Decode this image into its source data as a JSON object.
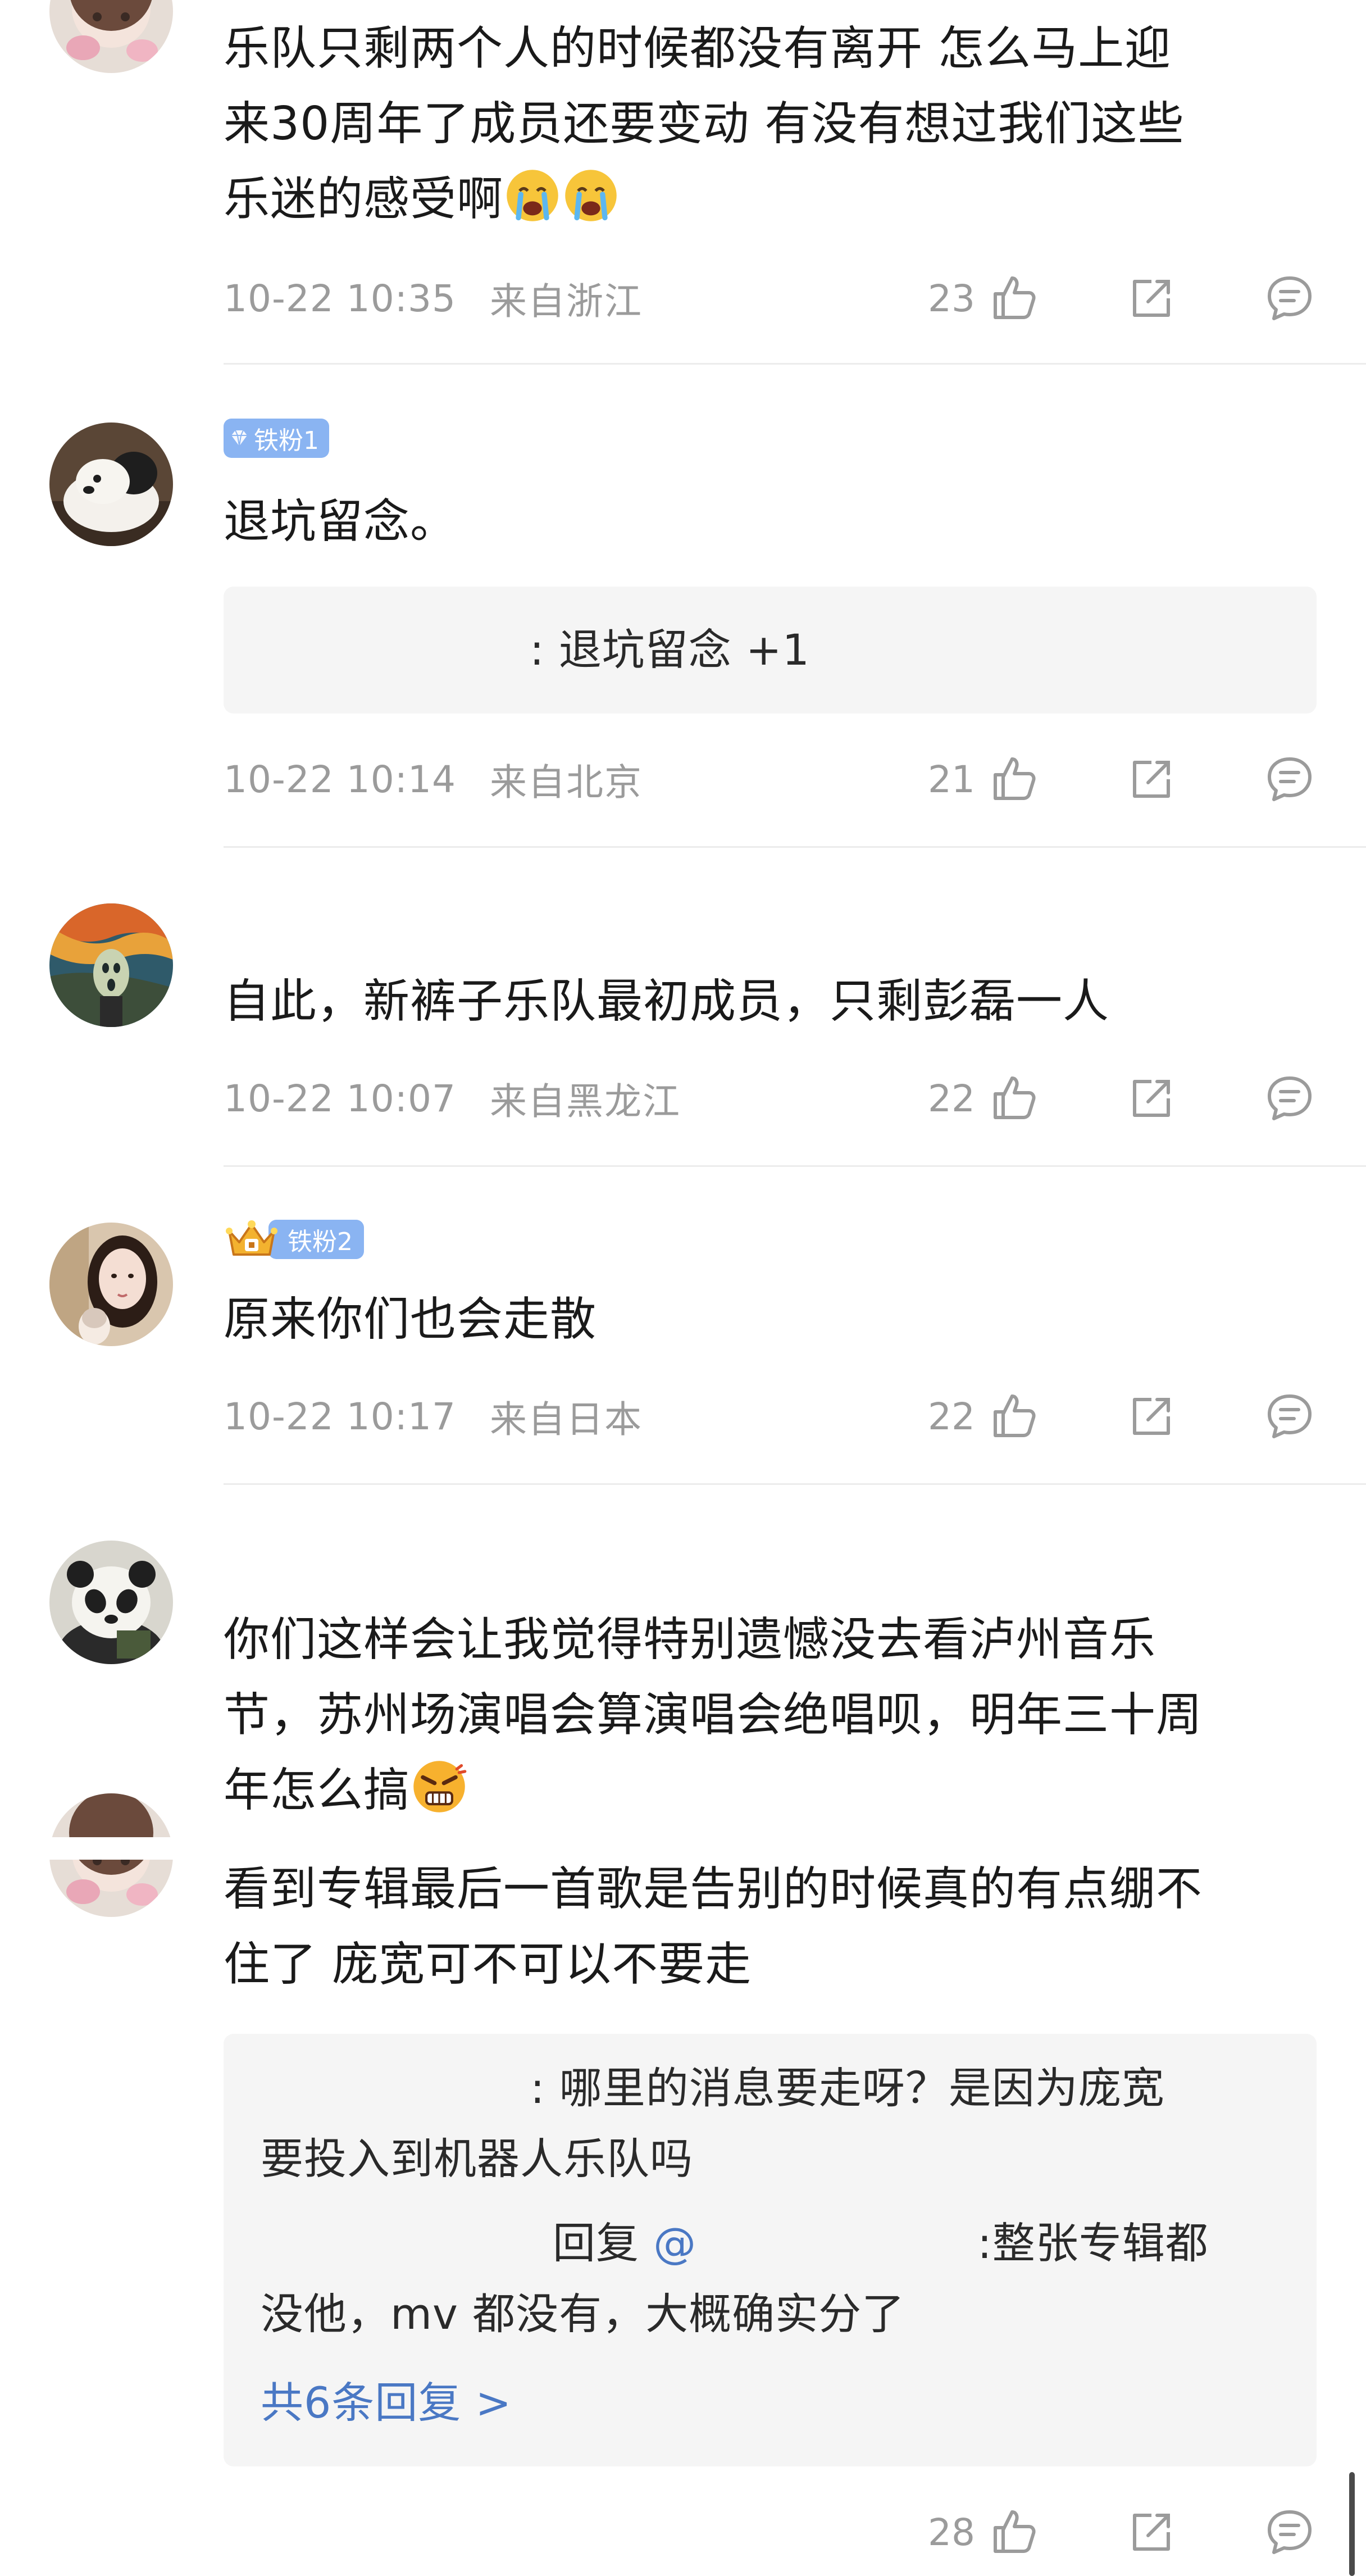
{
  "comments": [
    {
      "text": "乐队只剩两个人的时候都没有离开 怎么马上迎来30周年了成员还要变动 有没有想过我们这些乐迷的感受啊",
      "emoji": [
        "crying-face",
        "crying-face"
      ],
      "time": "10-22 10:35",
      "location": "来自浙江",
      "likes": "23"
    },
    {
      "badge": "铁粉1",
      "text": "退坑留念。",
      "reply": ": 退坑留念 +1",
      "time": "10-22 10:14",
      "location": "来自北京",
      "likes": "21"
    },
    {
      "text": "自此，新裤子乐队最初成员，只剩彭磊一人",
      "time": "10-22 10:07",
      "location": "来自黑龙江",
      "likes": "22"
    },
    {
      "badge": "铁粉2",
      "text": "原来你们也会走散",
      "time": "10-22 10:17",
      "location": "来自日本",
      "likes": "22"
    },
    {
      "text_lines": [
        "你们这样会让我觉得特别遗憾没去看泸州音乐",
        "节，苏州场演唱会算演唱会绝唱呗，明年三十周",
        "年怎么搞"
      ],
      "emoji": [
        "angry-face"
      ]
    },
    {
      "text_lines": [
        "看到专辑最后一首歌是告别的时候真的有点绷不",
        "住了 庞宽可不可以不要走"
      ],
      "replies": [
        {
          "lines": [
            ": 哪里的消息要走呀？是因为庞宽",
            "要投入到机器人乐队吗"
          ]
        },
        {
          "reply_word": "回复",
          "at": "@",
          "lines": [
            ":整张专辑都",
            "没他，mv 都没有，大概确实分了"
          ]
        }
      ],
      "more_replies": "共6条回复 >",
      "likes": "28"
    }
  ],
  "first_text_lines": [
    "乐队只剩两个人的时候都没有离开 怎么马上迎",
    "来30周年了成员还要变动 有没有想过我们这些",
    "乐迷的感受啊"
  ],
  "colors": {
    "badge_blue": "#8ab4f2",
    "link_blue": "#4a78c4",
    "meta_gray": "#9b9b9b",
    "reply_bg": "#f5f5f5"
  },
  "icons": {
    "like": "thumbs-up-icon",
    "share": "share-icon",
    "comment": "comment-icon"
  }
}
